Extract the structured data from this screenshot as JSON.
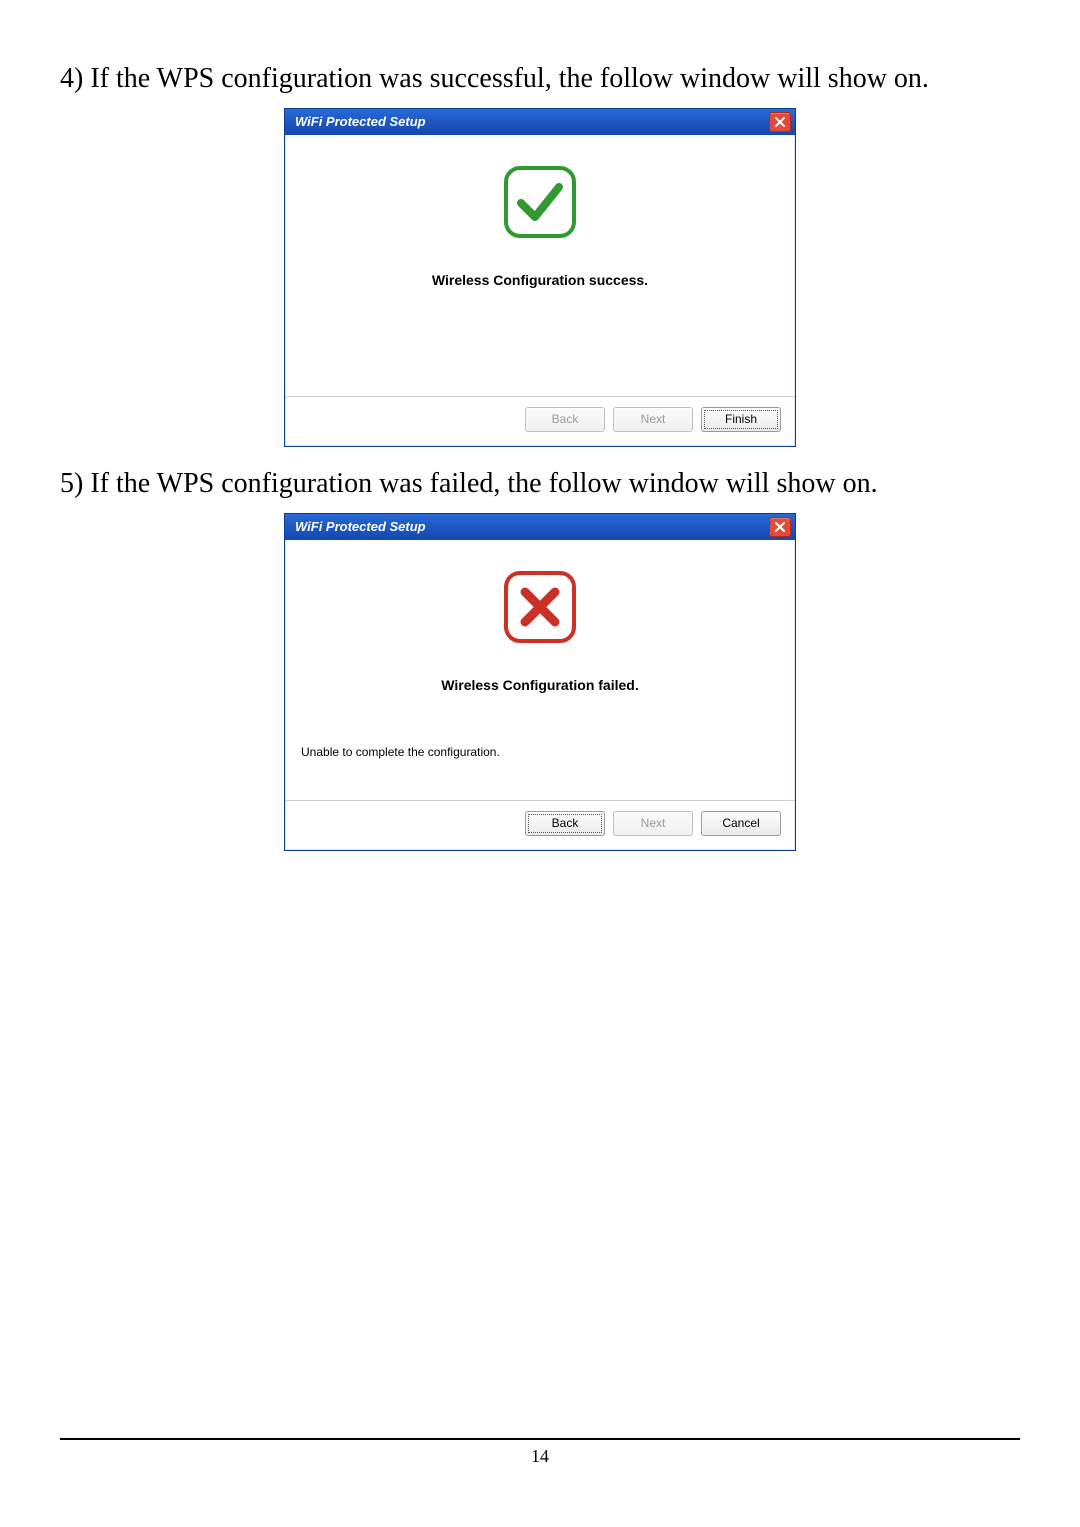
{
  "instructions": {
    "step4": "4) If the WPS configuration was successful, the follow window will show on.",
    "step5": "5) If the WPS configuration was failed, the follow window will show on."
  },
  "dialog_success": {
    "title": "WiFi Protected Setup",
    "status": "Wireless Configuration success.",
    "buttons": {
      "back": "Back",
      "next": "Next",
      "finish": "Finish"
    }
  },
  "dialog_failed": {
    "title": "WiFi Protected Setup",
    "status": "Wireless Configuration failed.",
    "sub": "Unable to complete the configuration.",
    "buttons": {
      "back": "Back",
      "next": "Next",
      "cancel": "Cancel"
    }
  },
  "page_number": "14"
}
